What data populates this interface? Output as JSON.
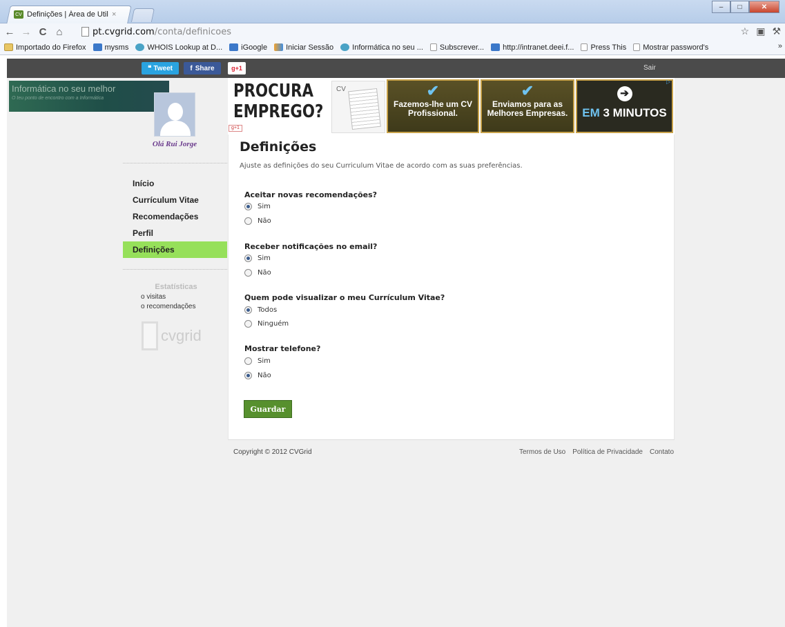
{
  "browser": {
    "tab_title": "Definições | Área de Utiliza",
    "tab_close": "×",
    "favicon_text": "CV",
    "url_host": "pt.cvgrid.com",
    "url_path": "/conta/definicoes",
    "bookmarks": [
      {
        "label": "Importado do Firefox",
        "icon": "folder-icon"
      },
      {
        "label": "mysms",
        "icon": "mysms-icon"
      },
      {
        "label": "WHOIS Lookup at D...",
        "icon": "whois-icon"
      },
      {
        "label": "iGoogle",
        "icon": "igoogle-icon"
      },
      {
        "label": "Iniciar Sessão",
        "icon": "login-icon"
      },
      {
        "label": "Informática no seu ...",
        "icon": "informatica-icon"
      },
      {
        "label": "Subscrever...",
        "icon": "page-icon"
      },
      {
        "label": "http://intranet.deei.f...",
        "icon": "intranet-icon"
      },
      {
        "label": "Press This",
        "icon": "page-icon"
      },
      {
        "label": "Mostrar password's",
        "icon": "page-icon"
      }
    ],
    "bookmarks_more": "»"
  },
  "topbar": {
    "tweet": "Tweet",
    "share": "Share",
    "plus_one": "+1",
    "logout": "Sair"
  },
  "site_banner": {
    "title": "Informática no seu melhor",
    "tagline": "O teu ponto de encontro com a Informática"
  },
  "sidebar": {
    "greeting": "Olá Rui Jorge",
    "items": [
      {
        "label": "Início",
        "active": false
      },
      {
        "label": "Currículum Vitae",
        "active": false
      },
      {
        "label": "Recomendações",
        "active": false
      },
      {
        "label": "Perfil",
        "active": false
      },
      {
        "label": "Definições",
        "active": true
      }
    ],
    "stats_title": "Estatísticas",
    "stats": [
      "visitas",
      "recomendações"
    ],
    "logo_text": "cvgrid"
  },
  "ad": {
    "headline": "PROCURA EMPREGO?",
    "cv_label": "CV",
    "panel1": "Fazemos-lhe um CV Profissional.",
    "panel2": "Enviamos para as Melhores Empresas.",
    "panel3_em": "EM",
    "panel3_rest": "3 MINUTOS",
    "plus_one": "+1"
  },
  "page": {
    "title": "Definições",
    "subtitle": "Ajuste as definições do seu Curriculum Vitae de acordo com as suas preferências.",
    "questions": [
      {
        "label": "Aceitar novas recomendações?",
        "options": [
          "Sim",
          "Não"
        ],
        "selected": 0
      },
      {
        "label": "Receber notificações no email?",
        "options": [
          "Sim",
          "Não"
        ],
        "selected": 0
      },
      {
        "label": "Quem pode visualizar o meu Currículum Vitae?",
        "options": [
          "Todos",
          "Ninguém"
        ],
        "selected": 0
      },
      {
        "label": "Mostrar telefone?",
        "options": [
          "Sim",
          "Não"
        ],
        "selected": 1
      }
    ],
    "save": "Guardar"
  },
  "footer": {
    "copyright": "Copyright © 2012 CVGrid",
    "links": [
      "Termos de Uso",
      "Política de Privacidade",
      "Contato"
    ]
  },
  "colors": {
    "active_nav": "#96e05a",
    "save_button": "#57902e",
    "topbar": "#4b4b4b"
  }
}
